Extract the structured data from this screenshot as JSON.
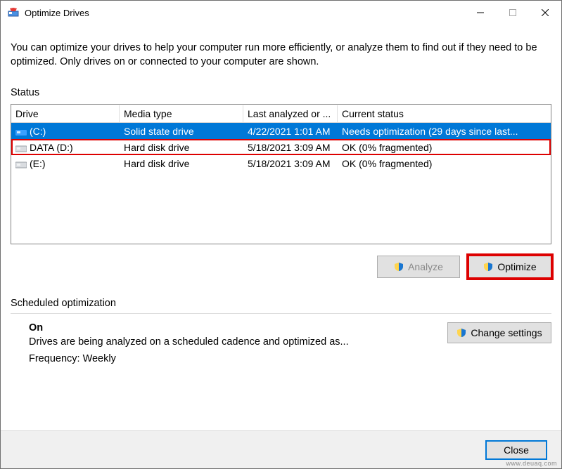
{
  "titlebar": {
    "title": "Optimize Drives"
  },
  "description": "You can optimize your drives to help your computer run more efficiently, or analyze them to find out if they need to be optimized. Only drives on or connected to your computer are shown.",
  "status": {
    "label": "Status",
    "headers": {
      "drive": "Drive",
      "media": "Media type",
      "analyzed": "Last analyzed or ...",
      "status": "Current status"
    },
    "rows": [
      {
        "name": "(C:)",
        "media": "Solid state drive",
        "analyzed": "4/22/2021 1:01 AM",
        "status": "Needs optimization (29 days since last...",
        "selected": true,
        "highlight": false,
        "iconColor": "#1e90ff"
      },
      {
        "name": "DATA (D:)",
        "media": "Hard disk drive",
        "analyzed": "5/18/2021 3:09 AM",
        "status": "OK (0% fragmented)",
        "selected": false,
        "highlight": true,
        "iconColor": "#9aa0a6"
      },
      {
        "name": "(E:)",
        "media": "Hard disk drive",
        "analyzed": "5/18/2021 3:09 AM",
        "status": "OK (0% fragmented)",
        "selected": false,
        "highlight": false,
        "iconColor": "#9aa0a6"
      }
    ]
  },
  "buttons": {
    "analyze": "Analyze",
    "optimize": "Optimize"
  },
  "scheduled": {
    "label": "Scheduled optimization",
    "on": "On",
    "line1": "Drives are being analyzed on a scheduled cadence and optimized as...",
    "line2": "Frequency: Weekly",
    "change": "Change settings"
  },
  "footer": {
    "close": "Close"
  },
  "watermark": "www.deuaq.com"
}
